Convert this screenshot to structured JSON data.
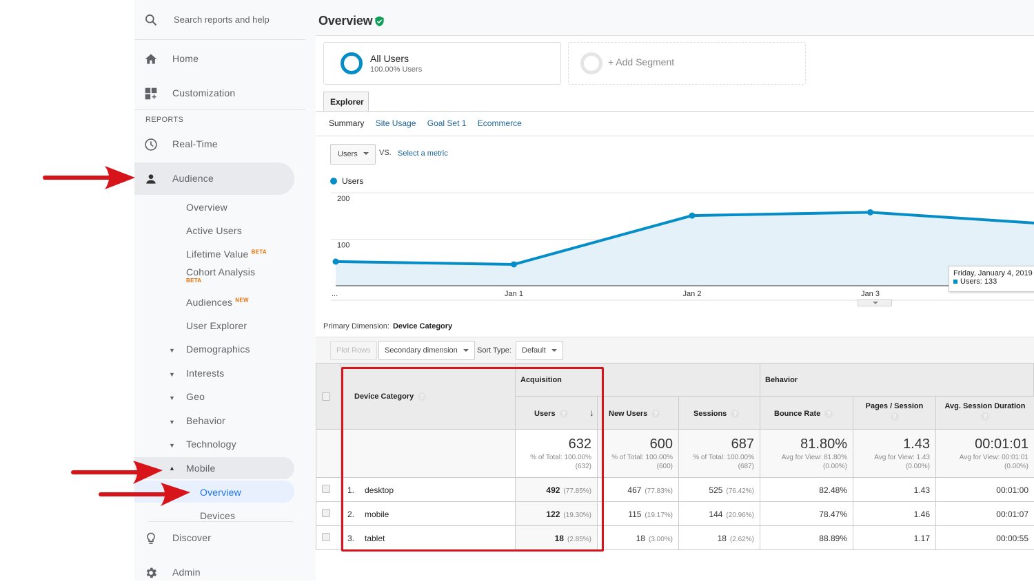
{
  "sidebar": {
    "search_placeholder": "Search reports and help",
    "items": {
      "home": "Home",
      "customization": "Customization",
      "reports_header": "REPORTS",
      "realtime": "Real-Time",
      "audience": "Audience",
      "discover": "Discover",
      "admin": "Admin"
    },
    "audience_sub": {
      "overview": "Overview",
      "active_users": "Active Users",
      "lifetime_value": "Lifetime Value",
      "lifetime_value_badge": "BETA",
      "cohort_analysis": "Cohort Analysis",
      "cohort_analysis_badge": "BETA",
      "audiences": "Audiences",
      "audiences_badge": "NEW",
      "user_explorer": "User Explorer",
      "demographics": "Demographics",
      "interests": "Interests",
      "geo": "Geo",
      "behavior": "Behavior",
      "technology": "Technology",
      "mobile": "Mobile",
      "mobile_overview": "Overview",
      "mobile_devices": "Devices"
    }
  },
  "header": {
    "title": "Overview"
  },
  "segments": {
    "all_users_name": "All Users",
    "all_users_sub": "100.00% Users",
    "add_segment": "+ Add Segment"
  },
  "explorer": {
    "tab": "Explorer",
    "subtabs": [
      "Summary",
      "Site Usage",
      "Goal Set 1",
      "Ecommerce"
    ],
    "metric_selected": "Users",
    "vs_label": "VS.",
    "select_metric": "Select a metric",
    "legend": "Users"
  },
  "chart_data": {
    "type": "area",
    "title": "",
    "series": [
      {
        "name": "Users",
        "color": "#058dc7",
        "values": [
          52,
          46,
          151,
          158,
          133
        ]
      }
    ],
    "x": [
      "...",
      "Jan 1",
      "Jan 2",
      "Jan 3",
      "Jan 4"
    ],
    "x_tick_labels": [
      "...",
      "Jan 1",
      "Jan 2",
      "Jan 3"
    ],
    "y_ticks": [
      100,
      200
    ],
    "ylim": [
      0,
      200
    ],
    "grid": true,
    "legend": "top-left",
    "tooltip": {
      "title": "Friday, January 4, 2019",
      "series": "Users",
      "value": 133
    }
  },
  "tooltip": {
    "title": "Friday, January 4, 2019",
    "label": "Users: 133"
  },
  "table_controls": {
    "primary_dimension_label": "Primary Dimension:",
    "primary_dimension_value": "Device Category",
    "plot_rows": "Plot Rows",
    "secondary_dimension": "Secondary dimension",
    "sort_type_label": "Sort Type:",
    "sort_type_value": "Default"
  },
  "table": {
    "dimension_header": "Device Category",
    "group_acquisition": "Acquisition",
    "group_behavior": "Behavior",
    "columns": [
      "Users",
      "New Users",
      "Sessions",
      "Bounce Rate",
      "Pages / Session",
      "Avg. Session Duration"
    ],
    "totals": [
      {
        "value": "632",
        "line1": "% of Total: 100.00%",
        "line2": "(632)"
      },
      {
        "value": "600",
        "line1": "% of Total: 100.00%",
        "line2": "(600)"
      },
      {
        "value": "687",
        "line1": "% of Total: 100.00%",
        "line2": "(687)"
      },
      {
        "value": "81.80%",
        "line1": "Avg for View: 81.80%",
        "line2": "(0.00%)"
      },
      {
        "value": "1.43",
        "line1": "Avg for View: 1.43",
        "line2": "(0.00%)"
      },
      {
        "value": "00:01:01",
        "line1": "Avg for View: 00:01:01",
        "line2": "(0.00%)"
      }
    ],
    "rows": [
      {
        "index": "1.",
        "name": "desktop",
        "users": "492",
        "users_pct": "(77.85%)",
        "new_users": "467",
        "new_users_pct": "(77.83%)",
        "sessions": "525",
        "sessions_pct": "(76.42%)",
        "bounce_rate": "82.48%",
        "pages_session": "1.43",
        "avg_duration": "00:01:00"
      },
      {
        "index": "2.",
        "name": "mobile",
        "users": "122",
        "users_pct": "(19.30%)",
        "new_users": "115",
        "new_users_pct": "(19.17%)",
        "sessions": "144",
        "sessions_pct": "(20.96%)",
        "bounce_rate": "78.47%",
        "pages_session": "1.46",
        "avg_duration": "00:01:07"
      },
      {
        "index": "3.",
        "name": "tablet",
        "users": "18",
        "users_pct": "(2.85%)",
        "new_users": "18",
        "new_users_pct": "(3.00%)",
        "sessions": "18",
        "sessions_pct": "(2.62%)",
        "bounce_rate": "88.89%",
        "pages_session": "1.17",
        "avg_duration": "00:00:55"
      }
    ],
    "help_glyph": "?"
  },
  "colors": {
    "accent": "#058dc7",
    "link": "#1a6499",
    "active_nav": "#1a73e8",
    "badge": "#e8710a",
    "annotation_red": "#d7141a",
    "verified_green": "#0f9d58"
  }
}
